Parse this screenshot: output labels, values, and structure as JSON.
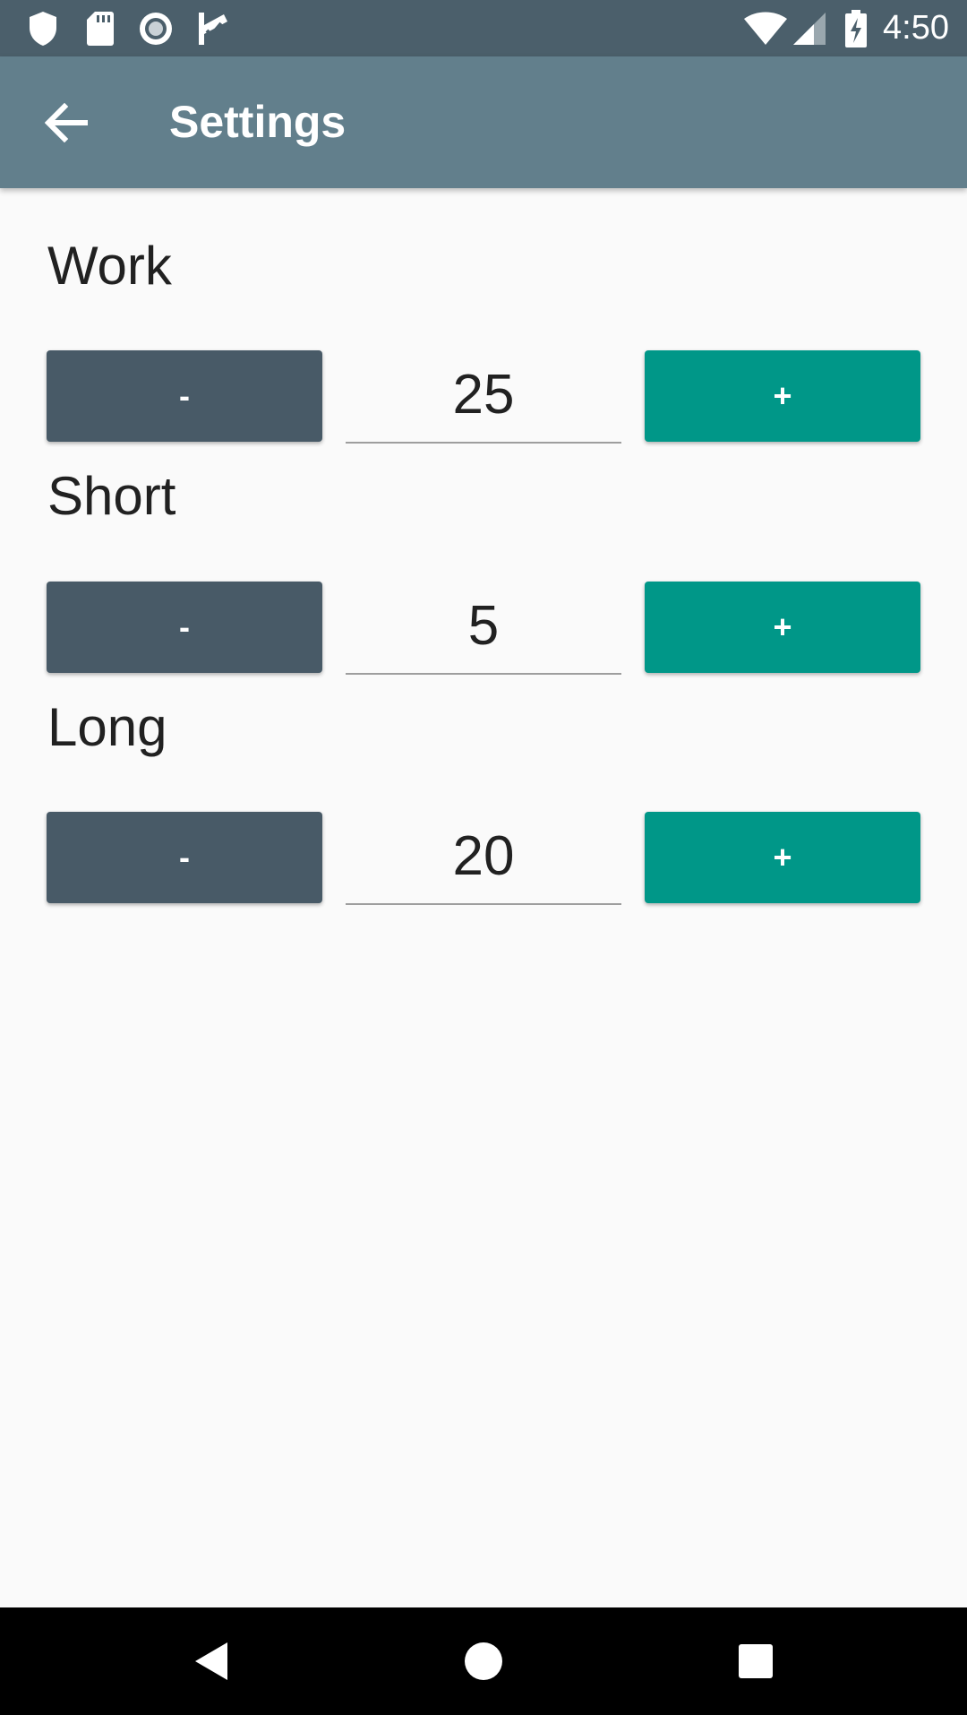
{
  "status_bar": {
    "time": "4:50",
    "icons": [
      "shield-icon",
      "sd-card-icon",
      "record-icon",
      "check-flag-icon",
      "wifi-icon",
      "signal-icon",
      "battery-charging-icon"
    ]
  },
  "app_bar": {
    "title": "Settings",
    "back_icon": "arrow-back-icon"
  },
  "settings": [
    {
      "label": "Work",
      "value": "25",
      "minus_label": "-",
      "plus_label": "+"
    },
    {
      "label": "Short",
      "value": "5",
      "minus_label": "-",
      "plus_label": "+"
    },
    {
      "label": "Long",
      "value": "20",
      "minus_label": "-",
      "plus_label": "+"
    }
  ],
  "colors": {
    "status_bar": "#4b5f6b",
    "app_bar": "#627f8c",
    "minus_button": "#485a67",
    "plus_button": "#009788"
  },
  "nav_bar": {
    "icons": [
      "back-triangle-icon",
      "home-circle-icon",
      "recents-square-icon"
    ]
  }
}
